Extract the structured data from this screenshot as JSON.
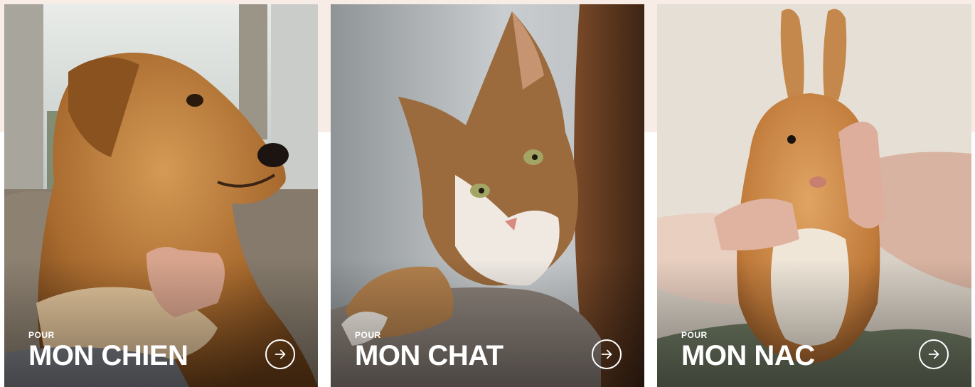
{
  "colors": {
    "background_strip": "#f8ece7",
    "caption_text": "#ffffff"
  },
  "cards": [
    {
      "kicker": "POUR",
      "title": "MON CHIEN",
      "photo_subject": "golden-retriever-dog",
      "arrow_icon": "arrow-right-circle-icon"
    },
    {
      "kicker": "POUR",
      "title": "MON CHAT",
      "photo_subject": "tabby-cat",
      "arrow_icon": "arrow-right-circle-icon"
    },
    {
      "kicker": "POUR",
      "title": "MON NAC",
      "photo_subject": "rabbit",
      "arrow_icon": "arrow-right-circle-icon"
    }
  ]
}
